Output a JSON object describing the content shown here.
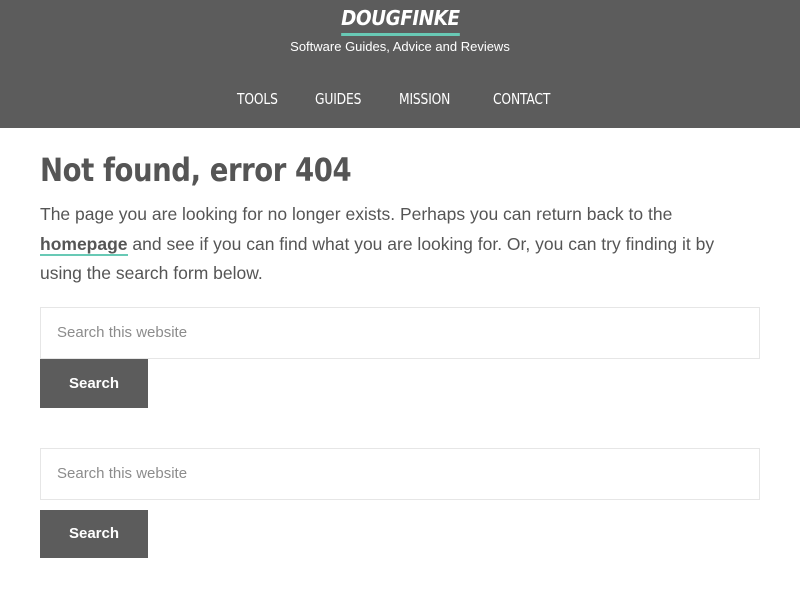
{
  "header": {
    "site_title": "DOUGFINKE",
    "tagline": "Software Guides, Advice and Reviews",
    "nav": {
      "tools": "TOOLS",
      "guides": "GUIDES",
      "mission": "MISSION",
      "contact": "CONTACT"
    },
    "background_color": "#5c5c5c",
    "accent_color": "#68c9b5"
  },
  "main": {
    "title": "Not found, error 404",
    "text_before_link": "The page you are looking for no longer exists. Perhaps you can return back to the ",
    "link_text": "homepage",
    "text_after_link": " and see if you can find what you are looking for. Or, you can try finding it by using the search form below."
  },
  "search_forms": [
    {
      "placeholder": "Search this website",
      "button_label": "Search"
    },
    {
      "placeholder": "Search this website",
      "button_label": "Search"
    }
  ]
}
